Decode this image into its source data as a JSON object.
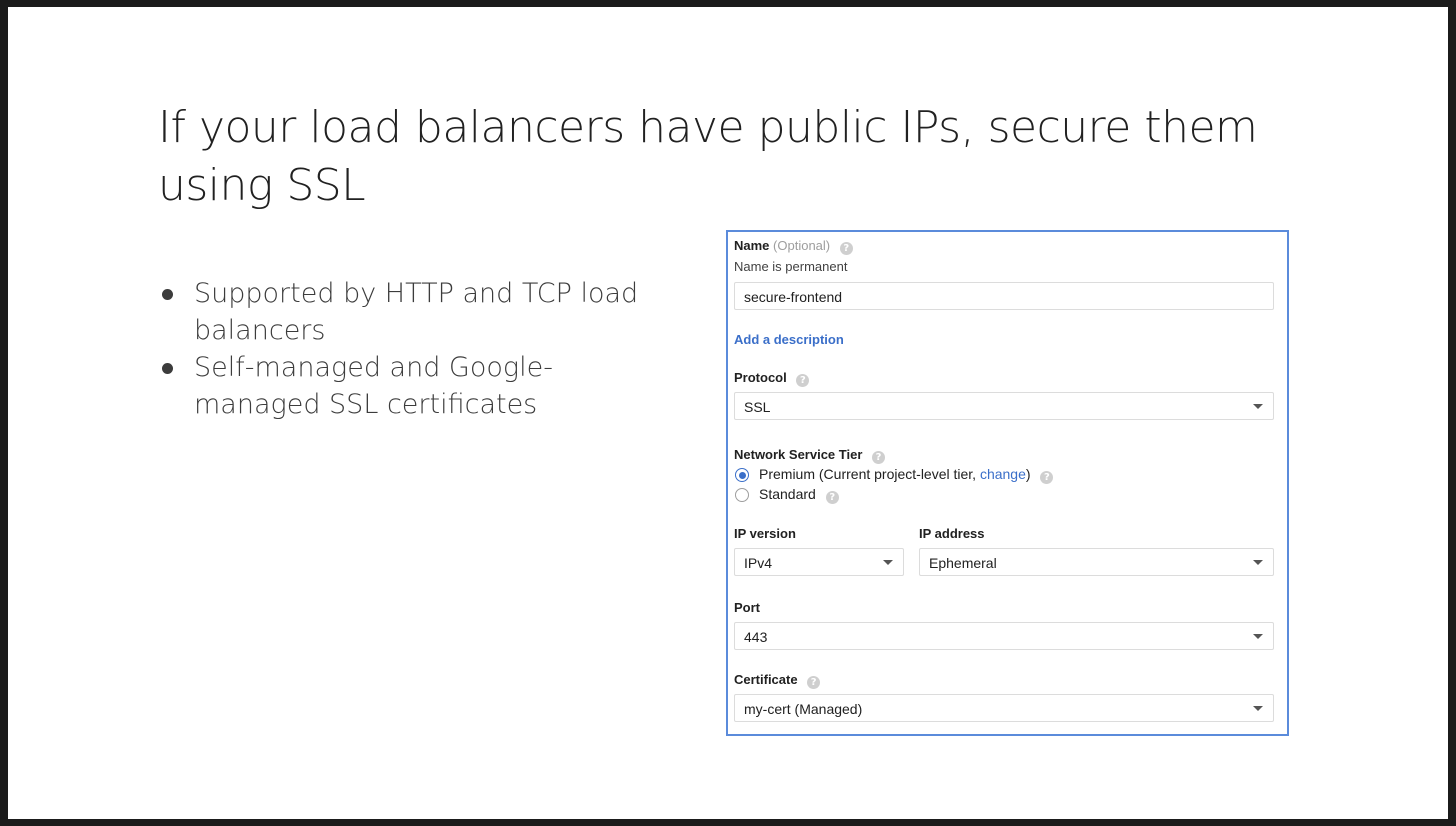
{
  "slide": {
    "title": "If your load balancers have public IPs, secure them using SSL",
    "bullets": [
      "Supported by HTTP and TCP load balancers",
      "Self-managed and Google-managed SSL certificates"
    ]
  },
  "form": {
    "name": {
      "label": "Name",
      "optional": "(Optional)",
      "hint": "Name is permanent",
      "value": "secure-frontend"
    },
    "add_description": "Add a description",
    "protocol": {
      "label": "Protocol",
      "value": "SSL"
    },
    "network_tier": {
      "label": "Network Service Tier",
      "premium_prefix": "Premium (Current project-level tier, ",
      "premium_link": "change",
      "premium_suffix": ")",
      "standard": "Standard",
      "selected": "Premium"
    },
    "ip_version": {
      "label": "IP version",
      "value": "IPv4"
    },
    "ip_address": {
      "label": "IP address",
      "value": "Ephemeral"
    },
    "port": {
      "label": "Port",
      "value": "443"
    },
    "certificate": {
      "label": "Certificate",
      "value": "my-cert (Managed)"
    },
    "help_glyph": "?"
  },
  "colors": {
    "accent": "#3b6fc9",
    "panel_border": "#5b8bdb"
  }
}
